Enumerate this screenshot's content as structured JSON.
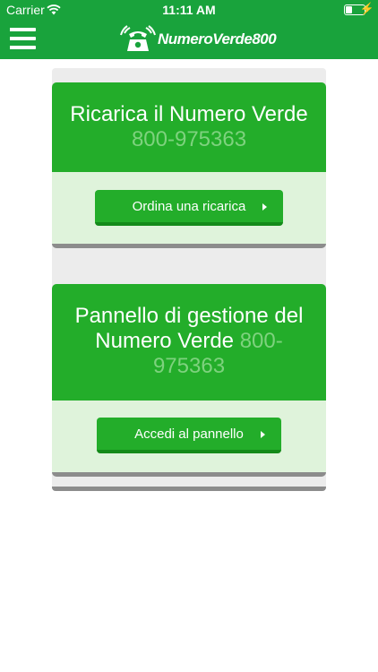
{
  "status_bar": {
    "carrier": "Carrier",
    "time": "11:11 AM",
    "battery_level": 0.3
  },
  "nav_bar": {
    "menu_icon": "hamburger-menu-icon",
    "logo_text": "NumeroVerde800",
    "logo_icon": "telephone-icon"
  },
  "cards": [
    {
      "title": "Ricarica il Numero Verde",
      "phone": "800-975363",
      "button_label": "Ordina una ricarica"
    },
    {
      "title": "Pannello di gestione del Numero Verde",
      "phone": "800-975363",
      "button_label": "Accedi al pannello"
    }
  ],
  "colors": {
    "brand_green": "#19a33c",
    "card_green": "#23ad2a",
    "card_body": "#dff3db",
    "phone_text": "#7ed27e"
  }
}
